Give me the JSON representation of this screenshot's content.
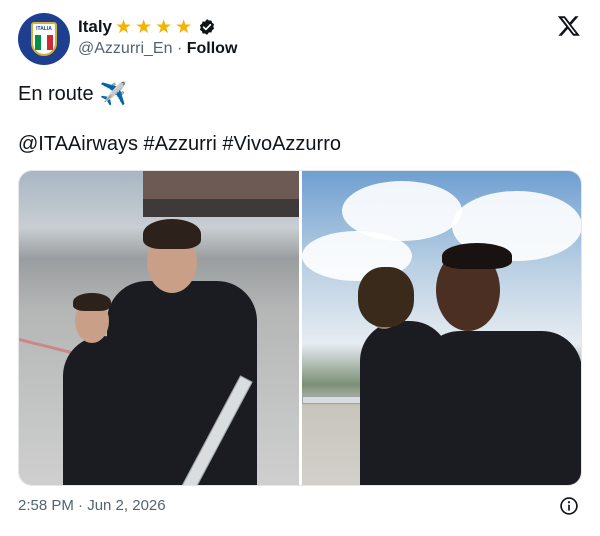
{
  "account": {
    "name": "Italy",
    "stars": [
      "★",
      "★",
      "★",
      "★"
    ],
    "handle": "@Azzurri_En",
    "separator": "·",
    "follow_label": "Follow",
    "avatar_text": "ITALIA"
  },
  "tweet": {
    "line1": "En route",
    "line1_emoji": "✈️",
    "line2": "@ITAAirways #Azzurri #VivoAzzurro"
  },
  "footer": {
    "timestamp": "2:58 PM · Jun 2, 2026"
  },
  "colors": {
    "star": "#f5b301",
    "avatar_bg": "#1e3f8f",
    "secondary_text": "#536471"
  }
}
